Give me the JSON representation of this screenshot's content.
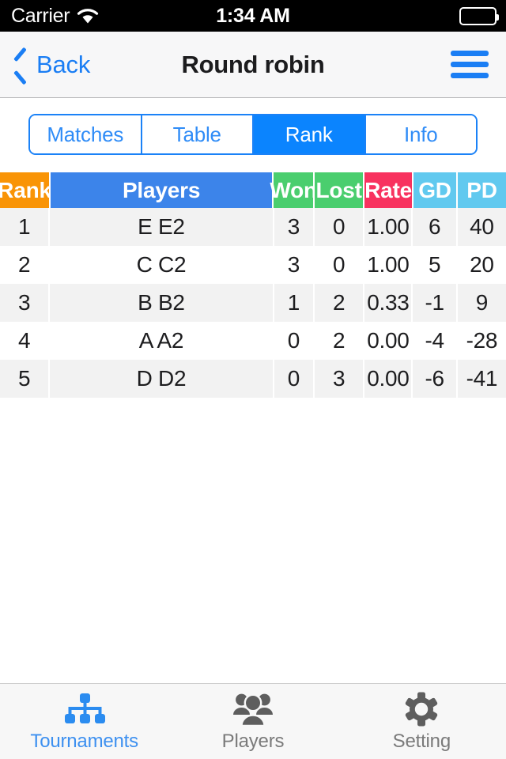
{
  "status_bar": {
    "carrier": "Carrier",
    "wifi_icon": "wifi-icon",
    "time": "1:34 AM",
    "battery_icon": "battery-icon"
  },
  "nav_bar": {
    "back_label": "Back",
    "back_icon": "chevron-left-icon",
    "title": "Round robin",
    "menu_icon": "hamburger-menu-icon"
  },
  "segmented_control": {
    "selected": "Rank",
    "options": [
      {
        "label": "Matches",
        "active": false
      },
      {
        "label": "Table",
        "active": false
      },
      {
        "label": "Rank",
        "active": true
      },
      {
        "label": "Info",
        "active": false
      }
    ]
  },
  "table": {
    "columns": [
      {
        "key": "rank",
        "label": "Rank",
        "color": "#f99406"
      },
      {
        "key": "players",
        "label": "Players",
        "color": "#3c84ea"
      },
      {
        "key": "won",
        "label": "Won",
        "color": "#4ace6e"
      },
      {
        "key": "lost",
        "label": "Lost",
        "color": "#4ace6e"
      },
      {
        "key": "rate",
        "label": "Rate",
        "color": "#f8325f"
      },
      {
        "key": "gd",
        "label": "GD",
        "color": "#61c9ef"
      },
      {
        "key": "pd",
        "label": "PD",
        "color": "#61c9ef"
      }
    ],
    "rows": [
      {
        "rank": "1",
        "players": "E E2",
        "won": "3",
        "lost": "0",
        "rate": "1.00",
        "gd": "6",
        "pd": "40"
      },
      {
        "rank": "2",
        "players": "C C2",
        "won": "3",
        "lost": "0",
        "rate": "1.00",
        "gd": "5",
        "pd": "20"
      },
      {
        "rank": "3",
        "players": "B B2",
        "won": "1",
        "lost": "2",
        "rate": "0.33",
        "gd": "-1",
        "pd": "9"
      },
      {
        "rank": "4",
        "players": "A A2",
        "won": "0",
        "lost": "2",
        "rate": "0.00",
        "gd": "-4",
        "pd": "-28"
      },
      {
        "rank": "5",
        "players": "D D2",
        "won": "0",
        "lost": "3",
        "rate": "0.00",
        "gd": "-6",
        "pd": "-41"
      }
    ]
  },
  "tab_bar": {
    "items": [
      {
        "label": "Tournaments",
        "icon": "org-chart-icon",
        "active": true
      },
      {
        "label": "Players",
        "icon": "people-group-icon",
        "active": false
      },
      {
        "label": "Setting",
        "icon": "gear-icon",
        "active": false
      }
    ]
  },
  "colors": {
    "accent_blue": "#0b84fe",
    "link_blue": "#1b7ef4",
    "tab_inactive": "#7a7a7a"
  }
}
